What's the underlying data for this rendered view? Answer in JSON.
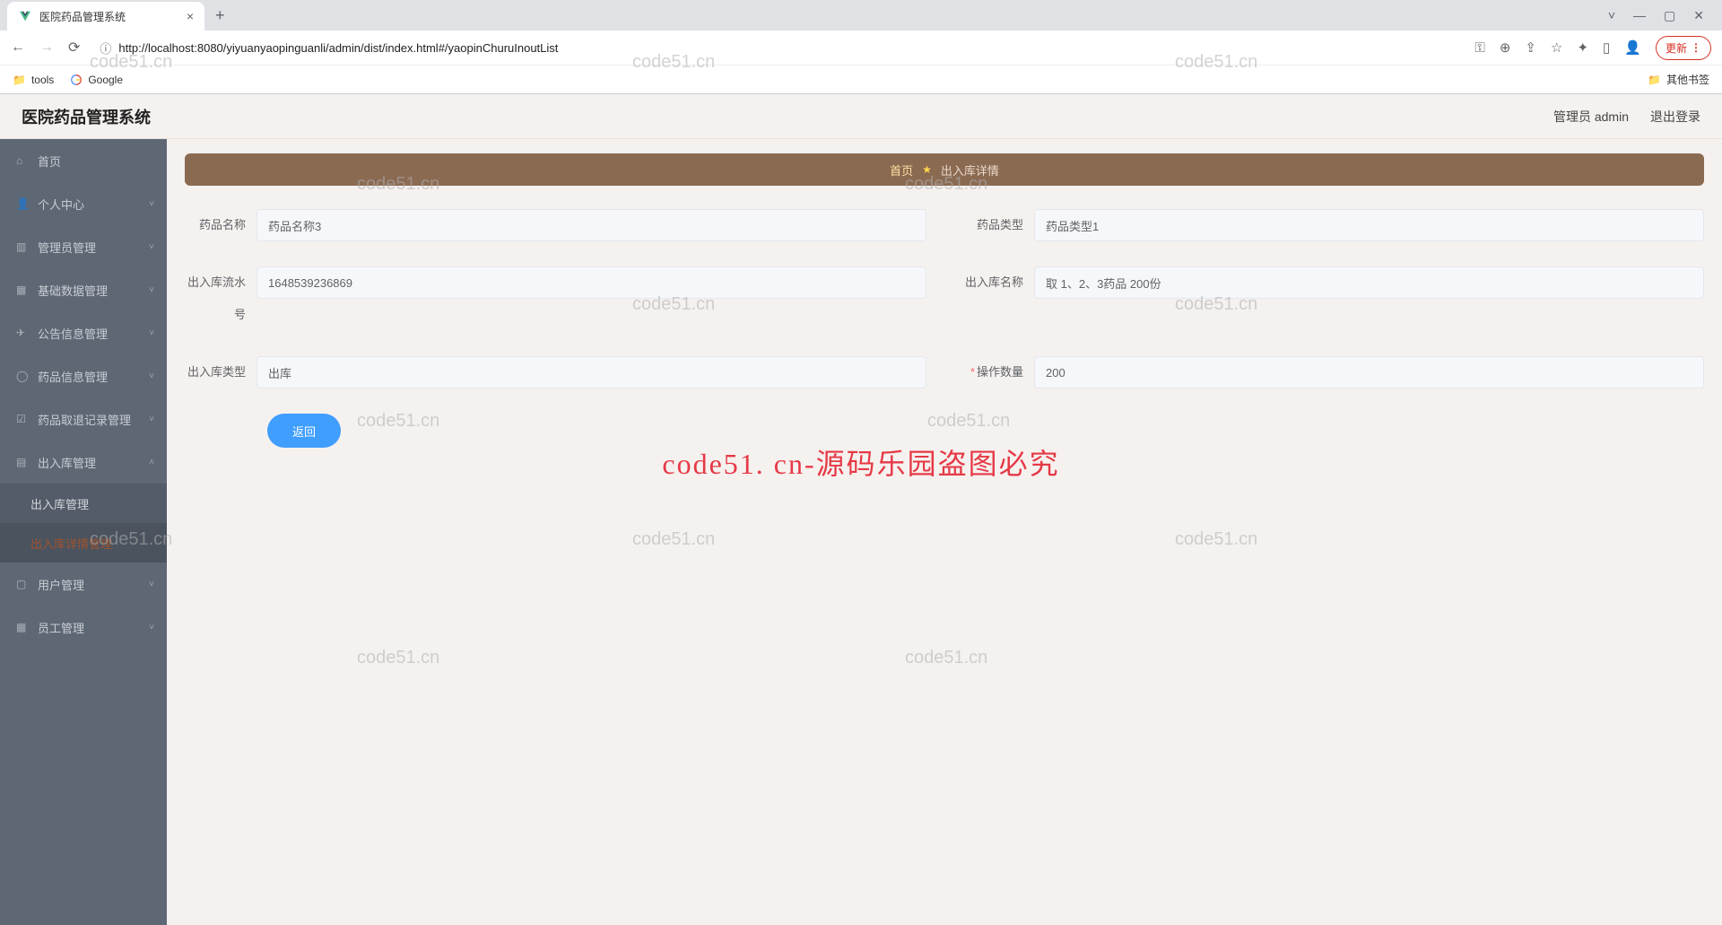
{
  "browser": {
    "tab_title": "医院药品管理系统",
    "url": "http://localhost:8080/yiyuanyaopinguanli/admin/dist/index.html#/yaopinChuruInoutList",
    "update_label": "更新",
    "bookmarks": {
      "tools": "tools",
      "google": "Google",
      "other": "其他书签"
    }
  },
  "header": {
    "app_title": "医院药品管理系统",
    "user_label": "管理员 admin",
    "logout_label": "退出登录"
  },
  "sidebar": {
    "home": "首页",
    "personal": "个人中心",
    "admin_mgmt": "管理员管理",
    "base_data": "基础数据管理",
    "announce": "公告信息管理",
    "medicine_info": "药品信息管理",
    "medicine_return": "药品取退记录管理",
    "inout_mgmt": "出入库管理",
    "inout_sub1": "出入库管理",
    "inout_sub2": "出入库详情管理",
    "user_mgmt": "用户管理",
    "staff_mgmt": "员工管理"
  },
  "breadcrumb": {
    "home": "首页",
    "current": "出入库详情"
  },
  "form": {
    "labels": {
      "medicine_name": "药品名称",
      "medicine_type": "药品类型",
      "serial_no": "出入库流水号",
      "inout_name": "出入库名称",
      "inout_type": "出入库类型",
      "op_qty": "操作数量"
    },
    "values": {
      "medicine_name": "药品名称3",
      "medicine_type": "药品类型1",
      "serial_no": "1648539236869",
      "inout_name": "取 1、2、3药品 200份",
      "inout_type": "出库",
      "op_qty": "200"
    },
    "back_label": "返回"
  },
  "watermarks": {
    "small": "code51.cn",
    "center": "code51. cn-源码乐园盗图必究"
  }
}
